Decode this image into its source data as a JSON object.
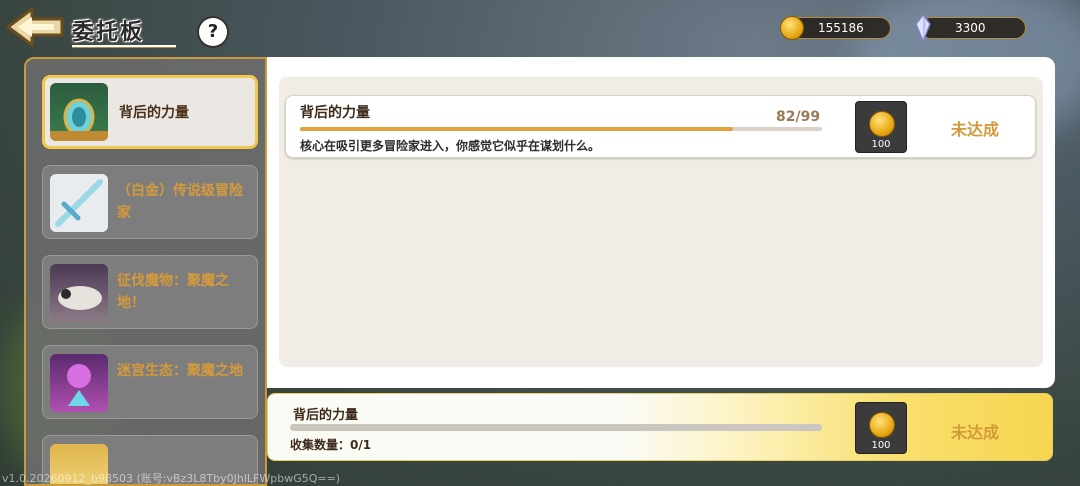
{
  "header": {
    "title": "委托板",
    "help_label": "?"
  },
  "currency": {
    "gold": "155186",
    "crystal": "3300"
  },
  "sidebar": {
    "items": [
      {
        "label": "背后的力量",
        "active": true
      },
      {
        "label": "（白金）传说级冒险家",
        "active": false
      },
      {
        "label": "征伐魔物：聚魔之地！",
        "active": false
      },
      {
        "label": "迷宫生态：聚魔之地",
        "active": false
      }
    ]
  },
  "quest": {
    "title": "背后的力量",
    "progress_text": "82/99",
    "progress": 0.83,
    "description": "核心在吸引更多冒险家进入，你感觉它似乎在谋划什么。",
    "reward_qty": "100",
    "status": "未达成"
  },
  "bottom": {
    "title": "背后的力量",
    "count_label": "收集数量：0/1",
    "progress": 0,
    "reward_qty": "100",
    "status": "未达成"
  },
  "footer": {
    "version": "v1.0.20260912_b98503 (账号:vBz3L8Tby0JhlLFWpbwG5Q==)"
  },
  "colors": {
    "accent_gold": "#c99a3c",
    "status_text": "#d29a3b",
    "progress_fill": "#e2a23a"
  }
}
